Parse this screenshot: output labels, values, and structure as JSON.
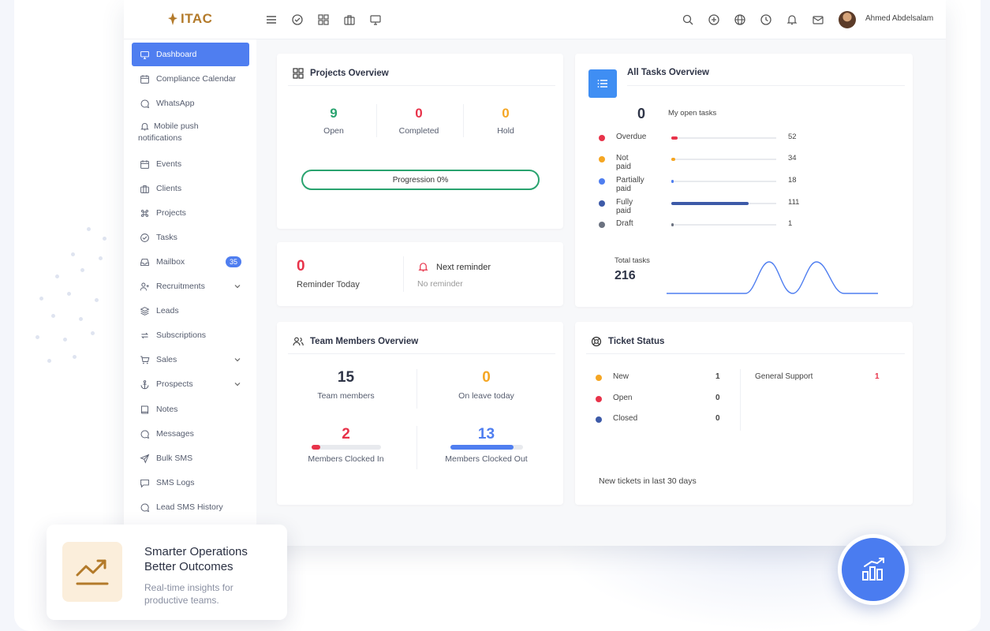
{
  "topbar": {
    "logo_text": "ITAC",
    "user_name": "Ahmed Abdelsalam",
    "left_icons": [
      "menu-icon",
      "check-circle-icon",
      "grid-icon",
      "briefcase-icon",
      "monitor-icon"
    ],
    "right_icons": [
      "search-icon",
      "plus-circle-icon",
      "globe-icon",
      "clock-icon",
      "bell-icon",
      "mail-icon"
    ]
  },
  "sidebar": {
    "items": [
      {
        "label": "Dashboard",
        "icon": "monitor-icon",
        "active": true
      },
      {
        "label": "Compliance Calendar",
        "icon": "calendar-icon"
      },
      {
        "label": "WhatsApp",
        "icon": "chat-icon"
      },
      {
        "label": "Mobile push notifications",
        "icon": "bell-icon"
      },
      {
        "label": "Events",
        "icon": "calendar-icon"
      },
      {
        "label": "Clients",
        "icon": "briefcase-icon"
      },
      {
        "label": "Projects",
        "icon": "command-icon"
      },
      {
        "label": "Tasks",
        "icon": "check-circle-icon"
      },
      {
        "label": "Mailbox",
        "icon": "inbox-icon",
        "badge": "35"
      },
      {
        "label": "Recruitments",
        "icon": "user-plus-icon",
        "expandable": true
      },
      {
        "label": "Leads",
        "icon": "layers-icon"
      },
      {
        "label": "Subscriptions",
        "icon": "repeat-icon"
      },
      {
        "label": "Sales",
        "icon": "cart-icon",
        "expandable": true
      },
      {
        "label": "Prospects",
        "icon": "anchor-icon",
        "expandable": true
      },
      {
        "label": "Notes",
        "icon": "book-icon"
      },
      {
        "label": "Messages",
        "icon": "chat-icon"
      },
      {
        "label": "Bulk SMS",
        "icon": "send-icon"
      },
      {
        "label": "SMS Logs",
        "icon": "message-square-icon"
      },
      {
        "label": "Lead SMS History",
        "icon": "chat-icon"
      }
    ]
  },
  "projects_overview": {
    "title": "Projects Overview",
    "stats": [
      {
        "value": "9",
        "label": "Open",
        "color": "#29a36f"
      },
      {
        "value": "0",
        "label": "Completed",
        "color": "#e8334a"
      },
      {
        "value": "0",
        "label": "Hold",
        "color": "#f5a623"
      }
    ],
    "progress_label": "Progression 0%",
    "progress_value": 0
  },
  "reminders": {
    "today_value": "0",
    "today_label": "Reminder Today",
    "next_title": "Next reminder",
    "next_value": "No reminder"
  },
  "tasks_overview": {
    "title": "All Tasks Overview",
    "open_count": "0",
    "open_label": "My open tasks",
    "rows": [
      {
        "label": "Overdue",
        "count": "52",
        "color": "#e8334a",
        "fraction": 0.06
      },
      {
        "label": "Not paid",
        "count": "34",
        "color": "#f5a623",
        "fraction": 0.04
      },
      {
        "label": "Partially paid",
        "count": "18",
        "color": "#4f7ef0",
        "fraction": 0.02
      },
      {
        "label": "Fully paid",
        "count": "111",
        "color": "#3d5aa8",
        "fraction": 0.74
      },
      {
        "label": "Draft",
        "count": "1",
        "color": "#6b7280",
        "fraction": 0.01
      }
    ],
    "total_label": "Total tasks",
    "total_value": "216"
  },
  "team_overview": {
    "title": "Team Members Overview",
    "members_value": "15",
    "members_label": "Team members",
    "leave_value": "0",
    "leave_label": "On leave today",
    "clocked_in_value": "2",
    "clocked_in_label": "Members Clocked In",
    "clocked_in_fraction": 0.13,
    "clocked_out_value": "13",
    "clocked_out_label": "Members Clocked Out",
    "clocked_out_fraction": 0.87
  },
  "ticket_status": {
    "title": "Ticket Status",
    "rows": [
      {
        "label": "New",
        "count": "1",
        "color": "#f5a623"
      },
      {
        "label": "Open",
        "count": "0",
        "color": "#e8334a"
      },
      {
        "label": "Closed",
        "count": "0",
        "color": "#3d5aa8"
      }
    ],
    "category_label": "General Support",
    "category_count": "1",
    "footer": "New tickets in last 30 days"
  },
  "promo": {
    "title_line1": "Smarter Operations",
    "title_line2": "Better Outcomes",
    "subtitle_line1": "Real-time insights for",
    "subtitle_line2": "productive teams."
  },
  "colors": {
    "accent": "#4f7ef0",
    "green": "#29a36f",
    "red": "#e8334a",
    "orange": "#f5a623",
    "brand_gold": "#b37a2a"
  }
}
